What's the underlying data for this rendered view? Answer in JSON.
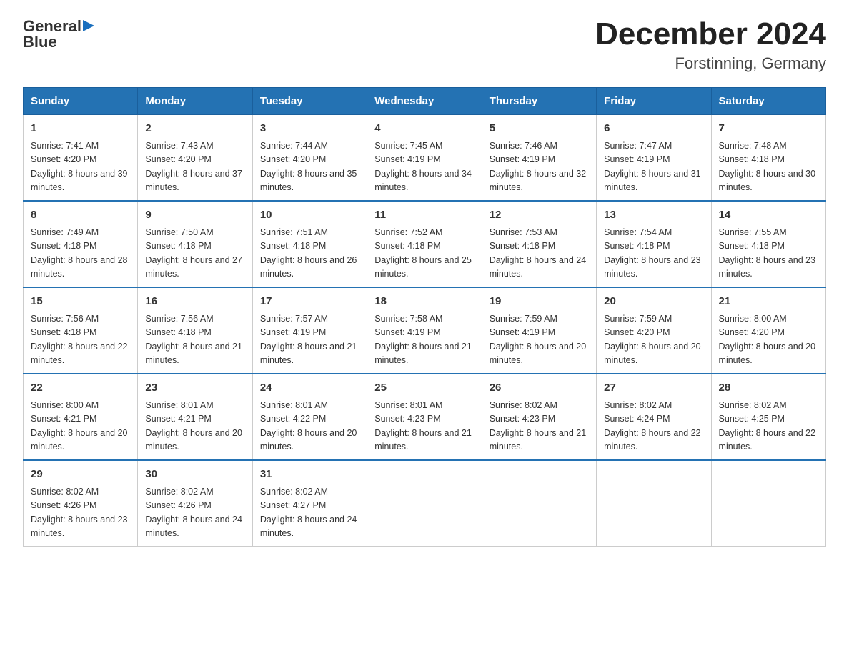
{
  "header": {
    "logo_line1": "General",
    "logo_line2": "Blue",
    "title": "December 2024",
    "subtitle": "Forstinning, Germany"
  },
  "days_of_week": [
    "Sunday",
    "Monday",
    "Tuesday",
    "Wednesday",
    "Thursday",
    "Friday",
    "Saturday"
  ],
  "weeks": [
    [
      {
        "day": "1",
        "sunrise": "7:41 AM",
        "sunset": "4:20 PM",
        "daylight": "8 hours and 39 minutes."
      },
      {
        "day": "2",
        "sunrise": "7:43 AM",
        "sunset": "4:20 PM",
        "daylight": "8 hours and 37 minutes."
      },
      {
        "day": "3",
        "sunrise": "7:44 AM",
        "sunset": "4:20 PM",
        "daylight": "8 hours and 35 minutes."
      },
      {
        "day": "4",
        "sunrise": "7:45 AM",
        "sunset": "4:19 PM",
        "daylight": "8 hours and 34 minutes."
      },
      {
        "day": "5",
        "sunrise": "7:46 AM",
        "sunset": "4:19 PM",
        "daylight": "8 hours and 32 minutes."
      },
      {
        "day": "6",
        "sunrise": "7:47 AM",
        "sunset": "4:19 PM",
        "daylight": "8 hours and 31 minutes."
      },
      {
        "day": "7",
        "sunrise": "7:48 AM",
        "sunset": "4:18 PM",
        "daylight": "8 hours and 30 minutes."
      }
    ],
    [
      {
        "day": "8",
        "sunrise": "7:49 AM",
        "sunset": "4:18 PM",
        "daylight": "8 hours and 28 minutes."
      },
      {
        "day": "9",
        "sunrise": "7:50 AM",
        "sunset": "4:18 PM",
        "daylight": "8 hours and 27 minutes."
      },
      {
        "day": "10",
        "sunrise": "7:51 AM",
        "sunset": "4:18 PM",
        "daylight": "8 hours and 26 minutes."
      },
      {
        "day": "11",
        "sunrise": "7:52 AM",
        "sunset": "4:18 PM",
        "daylight": "8 hours and 25 minutes."
      },
      {
        "day": "12",
        "sunrise": "7:53 AM",
        "sunset": "4:18 PM",
        "daylight": "8 hours and 24 minutes."
      },
      {
        "day": "13",
        "sunrise": "7:54 AM",
        "sunset": "4:18 PM",
        "daylight": "8 hours and 23 minutes."
      },
      {
        "day": "14",
        "sunrise": "7:55 AM",
        "sunset": "4:18 PM",
        "daylight": "8 hours and 23 minutes."
      }
    ],
    [
      {
        "day": "15",
        "sunrise": "7:56 AM",
        "sunset": "4:18 PM",
        "daylight": "8 hours and 22 minutes."
      },
      {
        "day": "16",
        "sunrise": "7:56 AM",
        "sunset": "4:18 PM",
        "daylight": "8 hours and 21 minutes."
      },
      {
        "day": "17",
        "sunrise": "7:57 AM",
        "sunset": "4:19 PM",
        "daylight": "8 hours and 21 minutes."
      },
      {
        "day": "18",
        "sunrise": "7:58 AM",
        "sunset": "4:19 PM",
        "daylight": "8 hours and 21 minutes."
      },
      {
        "day": "19",
        "sunrise": "7:59 AM",
        "sunset": "4:19 PM",
        "daylight": "8 hours and 20 minutes."
      },
      {
        "day": "20",
        "sunrise": "7:59 AM",
        "sunset": "4:20 PM",
        "daylight": "8 hours and 20 minutes."
      },
      {
        "day": "21",
        "sunrise": "8:00 AM",
        "sunset": "4:20 PM",
        "daylight": "8 hours and 20 minutes."
      }
    ],
    [
      {
        "day": "22",
        "sunrise": "8:00 AM",
        "sunset": "4:21 PM",
        "daylight": "8 hours and 20 minutes."
      },
      {
        "day": "23",
        "sunrise": "8:01 AM",
        "sunset": "4:21 PM",
        "daylight": "8 hours and 20 minutes."
      },
      {
        "day": "24",
        "sunrise": "8:01 AM",
        "sunset": "4:22 PM",
        "daylight": "8 hours and 20 minutes."
      },
      {
        "day": "25",
        "sunrise": "8:01 AM",
        "sunset": "4:23 PM",
        "daylight": "8 hours and 21 minutes."
      },
      {
        "day": "26",
        "sunrise": "8:02 AM",
        "sunset": "4:23 PM",
        "daylight": "8 hours and 21 minutes."
      },
      {
        "day": "27",
        "sunrise": "8:02 AM",
        "sunset": "4:24 PM",
        "daylight": "8 hours and 22 minutes."
      },
      {
        "day": "28",
        "sunrise": "8:02 AM",
        "sunset": "4:25 PM",
        "daylight": "8 hours and 22 minutes."
      }
    ],
    [
      {
        "day": "29",
        "sunrise": "8:02 AM",
        "sunset": "4:26 PM",
        "daylight": "8 hours and 23 minutes."
      },
      {
        "day": "30",
        "sunrise": "8:02 AM",
        "sunset": "4:26 PM",
        "daylight": "8 hours and 24 minutes."
      },
      {
        "day": "31",
        "sunrise": "8:02 AM",
        "sunset": "4:27 PM",
        "daylight": "8 hours and 24 minutes."
      },
      null,
      null,
      null,
      null
    ]
  ]
}
